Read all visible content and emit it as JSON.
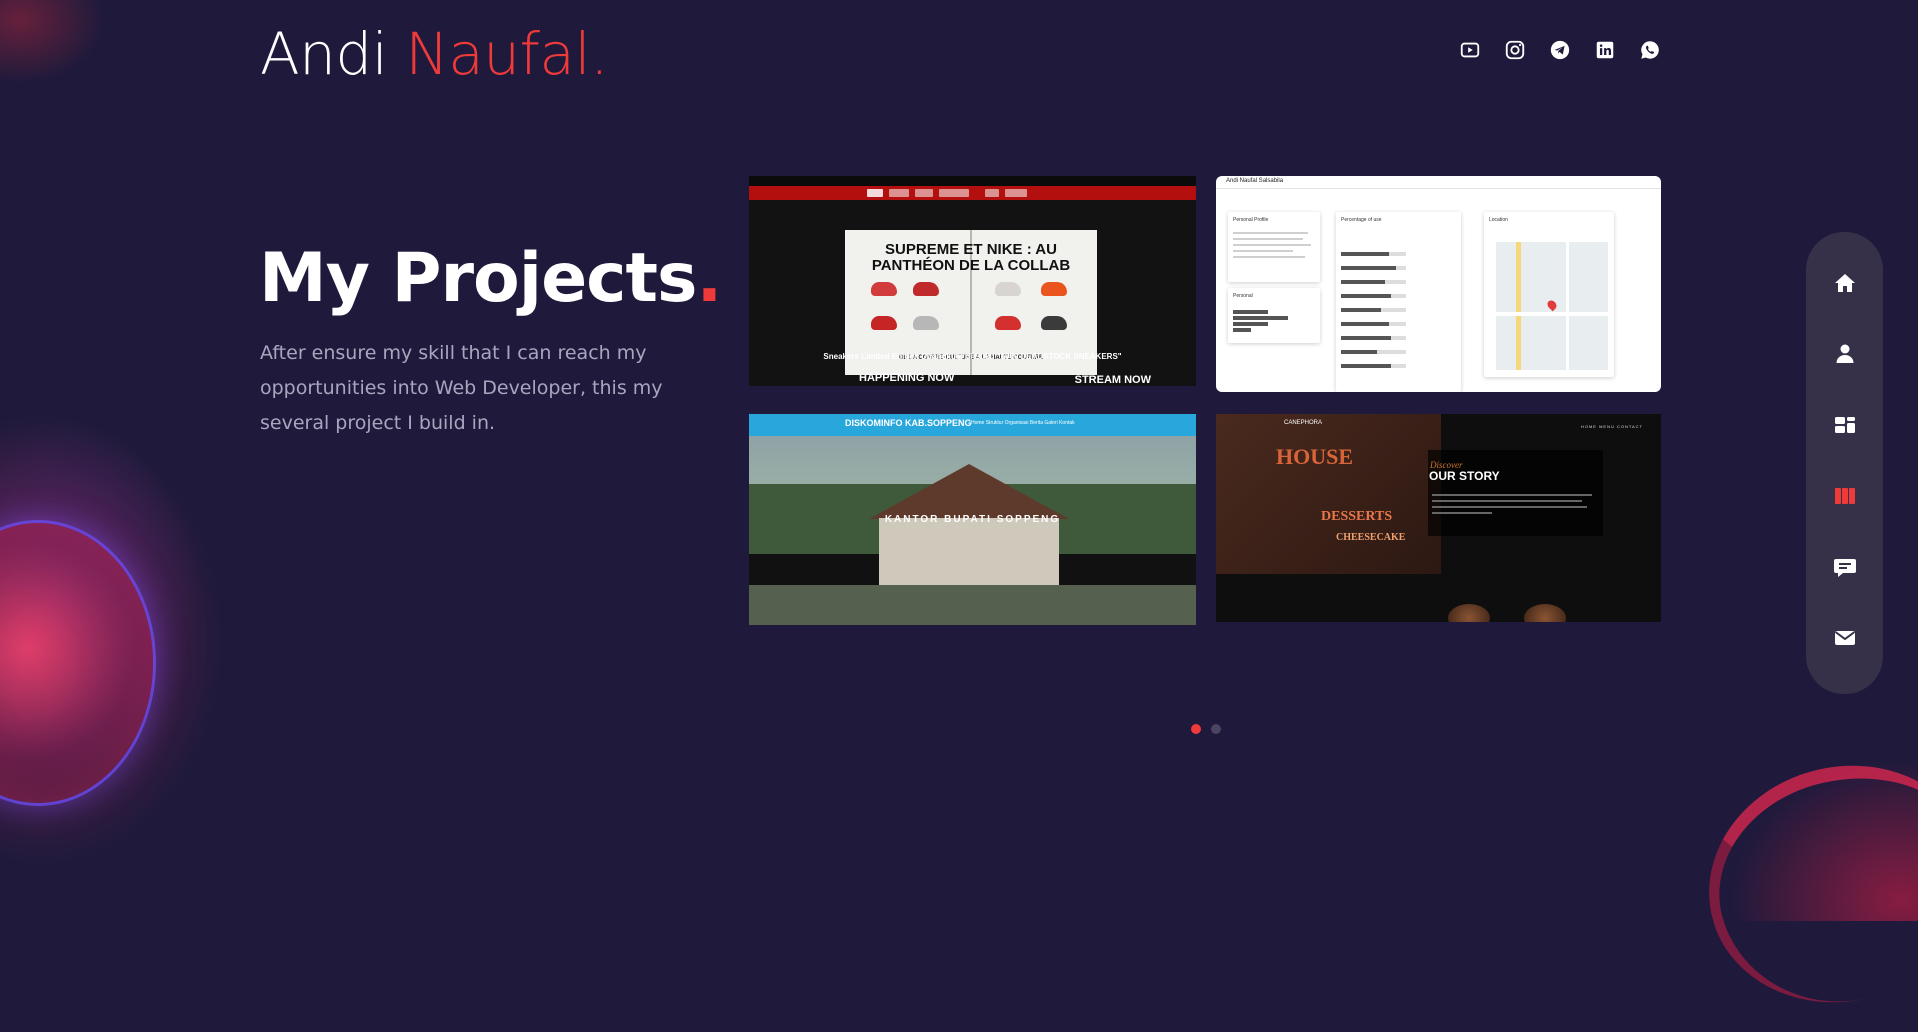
{
  "brand": {
    "first": "Andi ",
    "last": "Naufal."
  },
  "socials": [
    {
      "icon": "youtube-icon"
    },
    {
      "icon": "instagram-icon"
    },
    {
      "icon": "telegram-icon"
    },
    {
      "icon": "linkedin-icon"
    },
    {
      "icon": "whatsapp-icon"
    }
  ],
  "section": {
    "title": "My Projects",
    "title_dot": ".",
    "description": "After ensure my skill that I can reach my opportunities into Web Developer, this my several project I build in."
  },
  "projects": [
    {
      "headline": "SUPREME ET NIKE : AU PANTHÉON DE LA COLLAB",
      "caption": "DE LA CONTRE-CULTURE   À LA HAUTE COUTURE",
      "subtitle": "Sneakers Limited Edition Dirangkum di Buku \"1000 DEADSTOCK SNEAKERS\"",
      "cta_left": "HAPPENING NOW",
      "cta_right": "STREAM NOW"
    },
    {
      "name": "Andi Naufal Salsabila",
      "panel_profile": "Personal Profile",
      "panel_percentage": "Percentage of use",
      "panel_location": "Location",
      "panel_personal": "Personal"
    },
    {
      "logo": "DISKOMINFO KAB.SOPPENG",
      "menu": "Home   Struktur Organisasi   Berita   Galeri   Kontak",
      "title": "KANTOR BUPATI SOPPENG"
    },
    {
      "brand": "CANEPHORA",
      "nav": "HOME   MENU   CONTACT",
      "discover": "Discover",
      "story": "OUR STORY"
    }
  ],
  "pagination": {
    "total": 2,
    "active": 0
  },
  "sidenav": [
    {
      "icon": "home-icon",
      "active": false
    },
    {
      "icon": "user-icon",
      "active": false
    },
    {
      "icon": "dashboard-icon",
      "active": false
    },
    {
      "icon": "projects-icon",
      "active": true
    },
    {
      "icon": "chat-icon",
      "active": false
    },
    {
      "icon": "mail-icon",
      "active": false
    }
  ],
  "colors": {
    "accent": "#ef3a3a",
    "background": "#1f1a3b",
    "sidenav": "#363149"
  }
}
